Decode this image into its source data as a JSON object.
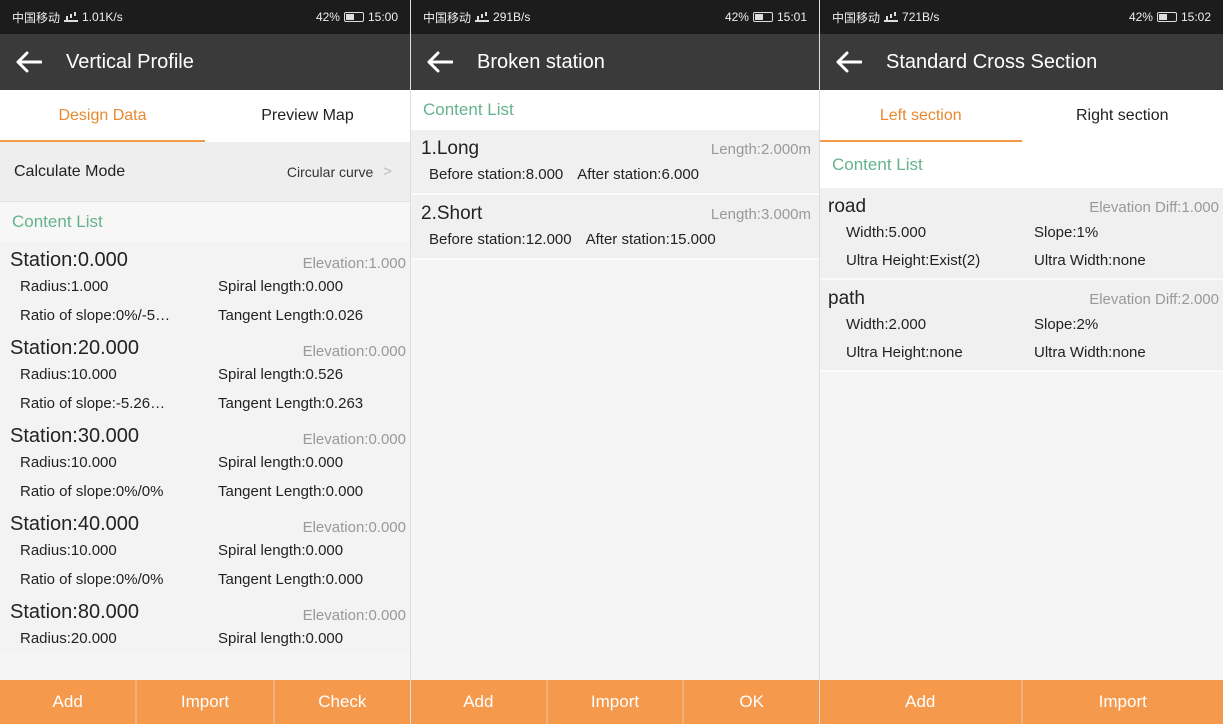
{
  "screens": [
    {
      "status": {
        "carrier": "中国移动",
        "speed": "1.01K/s",
        "battery": "42%",
        "time": "15:00"
      },
      "title": "Vertical Profile",
      "tabs": [
        "Design Data",
        "Preview Map"
      ],
      "mode": {
        "label": "Calculate Mode",
        "value": "Circular curve"
      },
      "section": "Content List",
      "items": [
        {
          "station": "Station:0.000",
          "elevation": "Elevation:1.000",
          "radius": "Radius:1.000",
          "spiral": "Spiral length:0.000",
          "ratio": "Ratio of slope:0%/-5…",
          "tangent": "Tangent Length:0.026"
        },
        {
          "station": "Station:20.000",
          "elevation": "Elevation:0.000",
          "radius": "Radius:10.000",
          "spiral": "Spiral length:0.526",
          "ratio": "Ratio of slope:-5.26…",
          "tangent": "Tangent Length:0.263"
        },
        {
          "station": "Station:30.000",
          "elevation": "Elevation:0.000",
          "radius": "Radius:10.000",
          "spiral": "Spiral length:0.000",
          "ratio": "Ratio of slope:0%/0%",
          "tangent": "Tangent Length:0.000"
        },
        {
          "station": "Station:40.000",
          "elevation": "Elevation:0.000",
          "radius": "Radius:10.000",
          "spiral": "Spiral length:0.000",
          "ratio": "Ratio of slope:0%/0%",
          "tangent": "Tangent Length:0.000"
        },
        {
          "station": "Station:80.000",
          "elevation": "Elevation:0.000",
          "radius": "Radius:20.000",
          "spiral": "Spiral length:0.000"
        }
      ],
      "buttons": [
        "Add",
        "Import",
        "Check"
      ]
    },
    {
      "status": {
        "carrier": "中国移动",
        "speed": "291B/s",
        "battery": "42%",
        "time": "15:01"
      },
      "title": "Broken station",
      "section": "Content List",
      "items": [
        {
          "title": "1.Long",
          "length": "Length:2.000m",
          "before": "Before station:8.000",
          "after": "After station:6.000"
        },
        {
          "title": "2.Short",
          "length": "Length:3.000m",
          "before": "Before station:12.000",
          "after": "After station:15.000"
        }
      ],
      "buttons": [
        "Add",
        "Import",
        "OK"
      ]
    },
    {
      "status": {
        "carrier": "中国移动",
        "speed": "721B/s",
        "battery": "42%",
        "time": "15:02"
      },
      "title": "Standard Cross Section",
      "tabs": [
        "Left section",
        "Right section"
      ],
      "section": "Content List",
      "items": [
        {
          "name": "road",
          "diff": "Elevation Diff:1.000",
          "width": "Width:5.000",
          "slope": "Slope:1%",
          "ultra_height": "Ultra Height:Exist(2)",
          "ultra_width": "Ultra Width:none"
        },
        {
          "name": "path",
          "diff": "Elevation Diff:2.000",
          "width": "Width:2.000",
          "slope": "Slope:2%",
          "ultra_height": "Ultra Height:none",
          "ultra_width": "Ultra Width:none"
        }
      ],
      "buttons": [
        "Add",
        "Import"
      ]
    }
  ],
  "icons": {
    "back": "arrow-left-icon",
    "chevron": "chevron-right-icon",
    "signal": "signal-icon",
    "wifi": "wifi-icon",
    "battery": "battery-icon"
  },
  "colors": {
    "accent": "#f29a48",
    "section_text": "#66b28e",
    "title_bar": "#3a3a3a",
    "status_bar": "#1c1c1c",
    "button": "#f59a4d"
  }
}
